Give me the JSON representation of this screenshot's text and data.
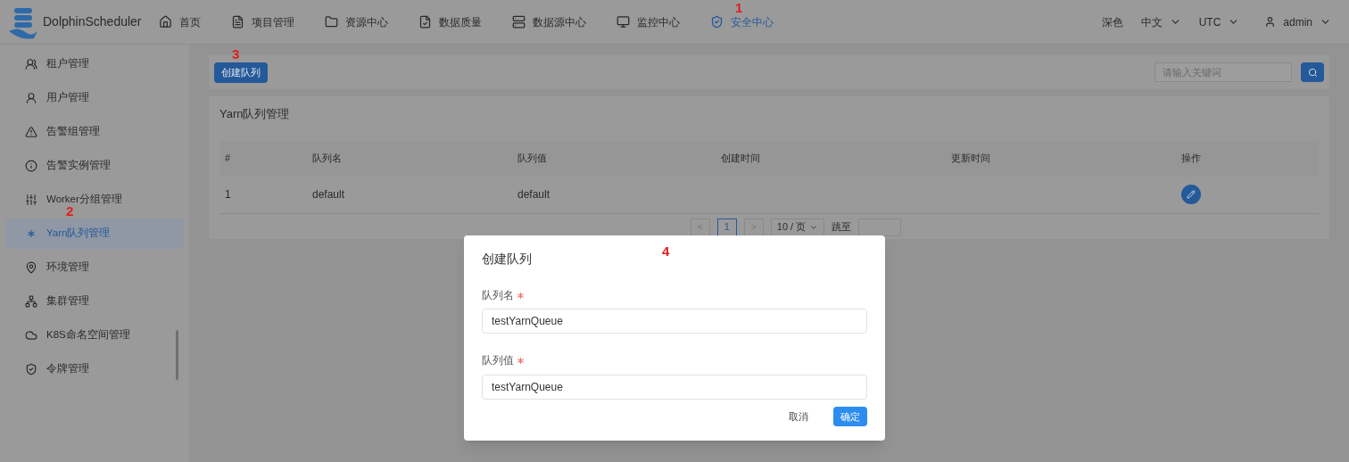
{
  "header": {
    "logo": "DolphinScheduler",
    "nav": [
      {
        "label": "首页",
        "selected": false
      },
      {
        "label": "项目管理",
        "selected": false
      },
      {
        "label": "资源中心",
        "selected": false
      },
      {
        "label": "数据质量",
        "selected": false
      },
      {
        "label": "数据源中心",
        "selected": false
      },
      {
        "label": "监控中心",
        "selected": false
      },
      {
        "label": "安全中心",
        "selected": true
      }
    ],
    "theme": "深色",
    "language": "中文",
    "timezone": "UTC",
    "user": "admin"
  },
  "sidebar": {
    "items": [
      {
        "label": "租户管理",
        "selected": false
      },
      {
        "label": "用户管理",
        "selected": false
      },
      {
        "label": "告警组管理",
        "selected": false
      },
      {
        "label": "告警实例管理",
        "selected": false
      },
      {
        "label": "Worker分组管理",
        "selected": false
      },
      {
        "label": "Yarn队列管理",
        "selected": true
      },
      {
        "label": "环境管理",
        "selected": false
      },
      {
        "label": "集群管理",
        "selected": false
      },
      {
        "label": "K8S命名空间管理",
        "selected": false
      },
      {
        "label": "令牌管理",
        "selected": false
      }
    ]
  },
  "toolbar": {
    "create_button": "创建队列",
    "search": {
      "placeholder": "请输入关键词"
    }
  },
  "card": {
    "title": "Yarn队列管理"
  },
  "table": {
    "columns": [
      "#",
      "队列名",
      "队列值",
      "创建时间",
      "更新时间",
      "操作"
    ],
    "rows": [
      {
        "index": "1",
        "name": "default",
        "value": "default"
      }
    ]
  },
  "pagination": {
    "prev": "<",
    "pages": [
      {
        "label": "1",
        "selected": true
      }
    ],
    "next": ">",
    "page_size": "10 / 页",
    "jump": "跳至"
  },
  "dialog": {
    "title": "创建队列",
    "fields": [
      {
        "label": "队列名",
        "required": true,
        "value": "testYarnQueue"
      },
      {
        "label": "队列值",
        "required": true,
        "value": "testYarnQueue"
      }
    ],
    "buttons": [
      {
        "label": "取消",
        "kind": "secondary"
      },
      {
        "label": "确定",
        "kind": "primary"
      }
    ]
  },
  "annotations": {
    "nav": "1",
    "sidebar": "2",
    "create": "3",
    "dialog": "4"
  }
}
